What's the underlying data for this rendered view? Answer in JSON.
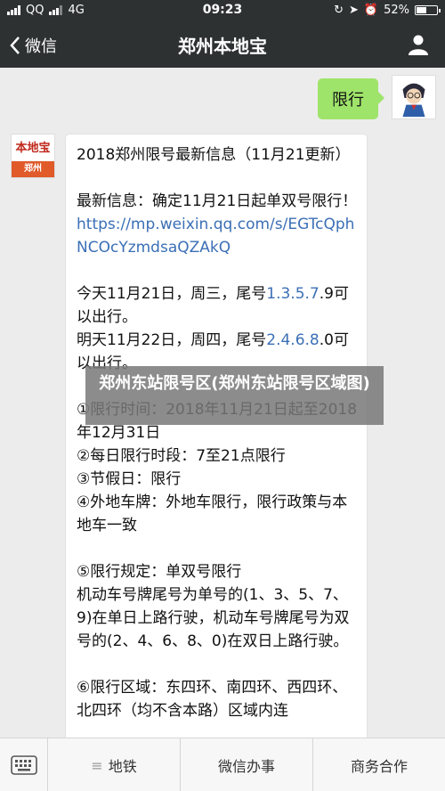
{
  "status_bar": {
    "carrier": "QQ",
    "network": "4G",
    "time": "09:23",
    "battery_percent_text": "52%",
    "battery_level": 0.52
  },
  "nav": {
    "back_label": "微信",
    "title": "郑州本地宝"
  },
  "chat": {
    "sent_message": "限行",
    "bot_logo": {
      "top": "本地宝",
      "bottom": "郑州"
    },
    "reply": {
      "title": "2018郑州限号最新信息（11月21更新）",
      "line1": "最新信息：确定11月21日起单双号限行！",
      "link": "https://mp.weixin.qq.com/s/EGTcQphNCOcYzmdsaQZAkQ",
      "today_prefix": "今天11月21日，周三，尾号",
      "today_numbers": "1.3.5.7",
      "today_suffix": ".9可以出行。",
      "tomorrow_prefix": "明天11月22日，周四，尾号",
      "tomorrow_numbers": "2.4.6.8",
      "tomorrow_suffix": ".0可以出行。",
      "rule1": "①限行时间：2018年11月21日起至2018年12月31日",
      "rule2": "②每日限行时段：7至21点限行",
      "rule3": "③节假日：限行",
      "rule4": "④外地车牌：外地车限行，限行政策与本地车一致",
      "rule5a": "⑤限行规定：单双号限行",
      "rule5b": "机动车号牌尾号为单号的(1、3、5、7、9)在单日上路行驶，机动车号牌尾号为双号的(2、4、6、8、0)在双日上路行驶。",
      "rule6": "⑥限行区域：东四环、南四环、西四环、北四环（均不含本路）区域内连"
    }
  },
  "overlay_caption": "郑州东站限号区(郑州东站限号区域图)",
  "menu": {
    "items": [
      "地铁",
      "微信办事",
      "商务合作"
    ]
  }
}
